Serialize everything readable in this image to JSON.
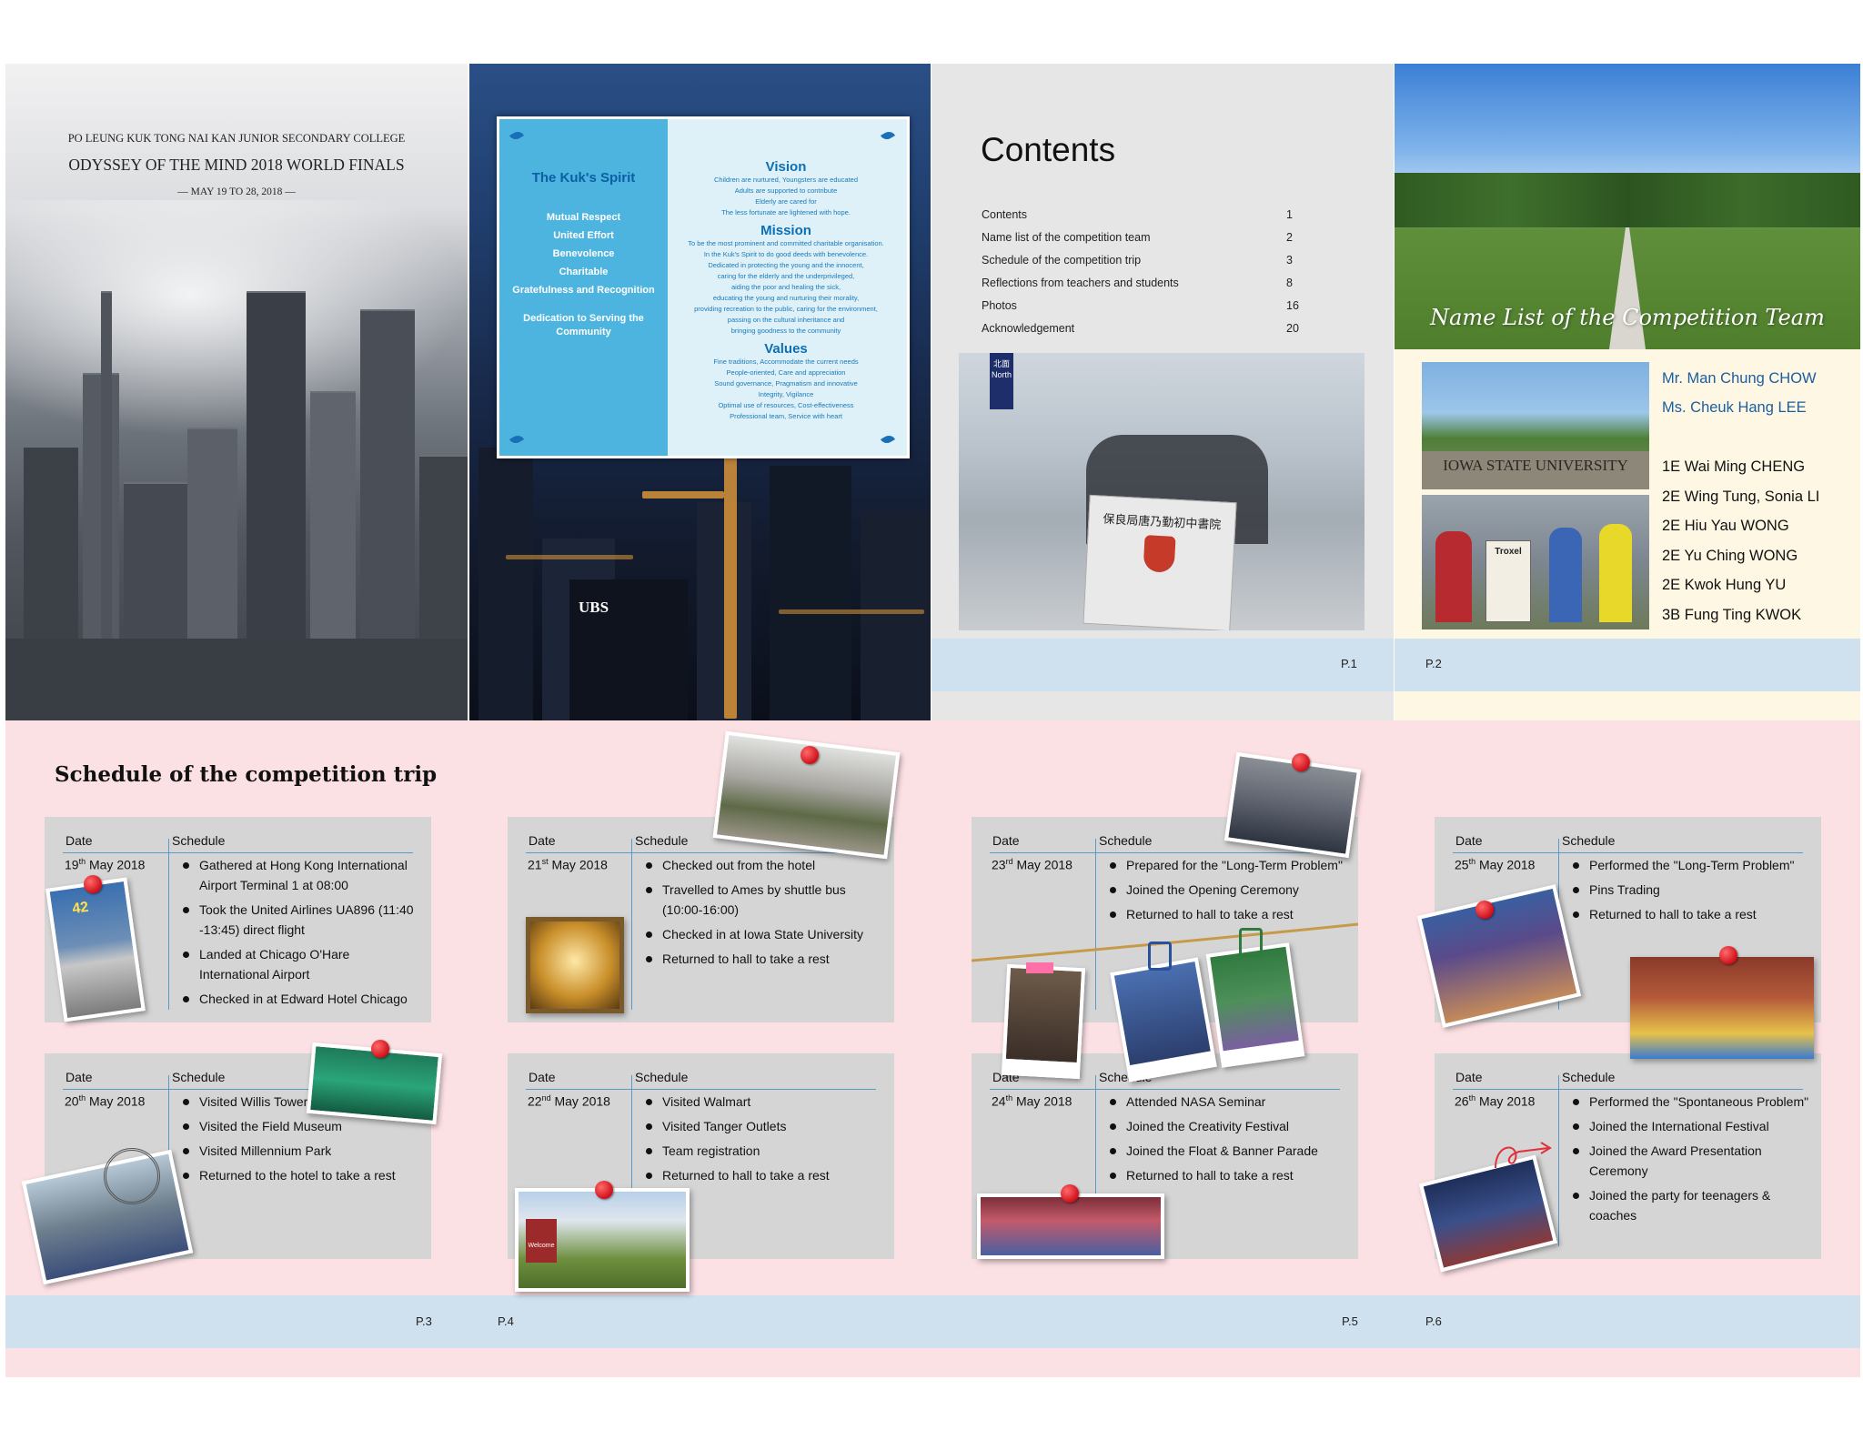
{
  "cover": {
    "school": "PO LEUNG KUK TONG NAI KAN JUNIOR SECONDARY COLLEGE",
    "title": "ODYSSEY OF THE MIND 2018 WORLD FINALS",
    "dates": "— MAY 19 TO 28, 2018 —"
  },
  "kuk_spirit": {
    "heading": "The Kuk's Spirit",
    "items": [
      "Mutual Respect",
      "United Effort",
      "Benevolence",
      "Charitable",
      "Gratefulness and Recognition"
    ],
    "dedication": "Dedication to Serving the Community",
    "vision_title": "Vision",
    "vision_lines": [
      "Children are nurtured, Youngsters are educated",
      "Adults are supported to contribute",
      "Elderly are cared for",
      "The less fortunate are lightened with hope."
    ],
    "mission_title": "Mission",
    "mission_lines": [
      "To be the most prominent and committed charitable organisation.",
      "In the Kuk's Spirit to do good deeds with benevolence.",
      "Dedicated in protecting the young and the innocent,",
      "caring for the elderly and the underprivileged,",
      "aiding the poor and healing the sick,",
      "educating the young and nurturing their morality,",
      "providing recreation to the public, caring for the environment,",
      "passing on the cultural inheritance and",
      "bringing goodness to the community"
    ],
    "values_title": "Values",
    "values_lines": [
      "Fine traditions, Accommodate the current needs",
      "People-oriented, Care and appreciation",
      "Sound governance, Pragmatism and innovative",
      "Integrity, Vigilance",
      "Optimal use of resources, Cost-effectiveness",
      "Professional team, Service with heart"
    ]
  },
  "contents": {
    "title": "Contents",
    "rows": [
      {
        "label": "Contents",
        "page": "1"
      },
      {
        "label": "Name list of the competition team",
        "page": "2"
      },
      {
        "label": "Schedule of the competition trip",
        "page": "3"
      },
      {
        "label": "Reflections from teachers  and students",
        "page": "8"
      },
      {
        "label": "Photos",
        "page": "16"
      },
      {
        "label": "Acknowledgement",
        "page": "20"
      }
    ],
    "banner_text": "保良局唐乃勤初中書院",
    "sign_text": "北面 North",
    "page_label": "P.1"
  },
  "namelist": {
    "title": "Name List of the Competition Team",
    "sign": "IOWA STATE UNIVERSITY",
    "teachers": [
      "Mr. Man Chung CHOW",
      "Ms. Cheuk Hang LEE"
    ],
    "students": [
      "1E Wai Ming CHENG",
      "2E Wing Tung, Sonia LI",
      "2E Hiu Yau WONG",
      "2E Yu Ching WONG",
      "2E Kwok Hung YU",
      "3B Fung Ting KWOK"
    ],
    "page_label": "P.2"
  },
  "schedule": {
    "title": "Schedule of the competition trip",
    "date_header": "Date",
    "schedule_header": "Schedule",
    "days": [
      {
        "date": "19",
        "sup": "th",
        "month": " May 2018",
        "items": [
          "Gathered at Hong Kong International Airport Terminal 1 at 08:00",
          "Took the United Airlines UA896 (11:40 -13:45) direct flight",
          "Landed at  Chicago O'Hare International Airport",
          "Checked in at Edward  Hotel Chicago"
        ]
      },
      {
        "date": "20",
        "sup": "th",
        "month": " May 2018",
        "items": [
          "Visited Willis Tower",
          "Visited the Field Museum",
          "Visited Millennium Park",
          "Returned to the hotel to take a rest"
        ]
      },
      {
        "date": "21",
        "sup": "st",
        "month": " May 2018",
        "items": [
          "Checked out from the hotel",
          "Travelled to Ames by shuttle bus (10:00-16:00)",
          "Checked in at Iowa State University",
          "Returned to hall to take a rest"
        ]
      },
      {
        "date": "22",
        "sup": "nd",
        "month": " May 2018",
        "items": [
          "Visited Walmart",
          "Visited Tanger Outlets",
          "Team registration",
          "Returned to hall to take a rest"
        ]
      },
      {
        "date": "23",
        "sup": "rd",
        "month": " May 2018",
        "items": [
          "Prepared for the \"Long-Term Problem\"",
          "Joined the Opening Ceremony",
          "Returned to hall to take a rest"
        ]
      },
      {
        "date": "24",
        "sup": "th",
        "month": " May 2018",
        "items": [
          "Attended NASA Seminar",
          "Joined the Creativity Festival",
          "Joined the Float & Banner Parade",
          "Returned to hall to take a rest"
        ]
      },
      {
        "date": "25",
        "sup": "th",
        "month": " May 2018",
        "items": [
          "Performed the \"Long-Term Problem\"",
          "Pins Trading",
          "Returned to hall to take a rest"
        ]
      },
      {
        "date": "26",
        "sup": "th",
        "month": " May 2018",
        "items": [
          "Performed the \"Spontaneous Problem\"",
          "Joined the International Festival",
          "Joined the Award Presentation Ceremony",
          "Joined the party for teenagers & coaches"
        ]
      }
    ],
    "page_labels": [
      "P.3",
      "P.4",
      "P.5",
      "P.6"
    ],
    "photo_labels": {
      "sign42": "42",
      "ubs": "UBS",
      "welcome": "Welcome",
      "troxel": "Troxel"
    }
  },
  "colors": {
    "pink": "#fbe0e4",
    "band": "#cfe1ee",
    "accent_blue": "#1b5fa0",
    "card_grey": "#d5d5d5"
  }
}
